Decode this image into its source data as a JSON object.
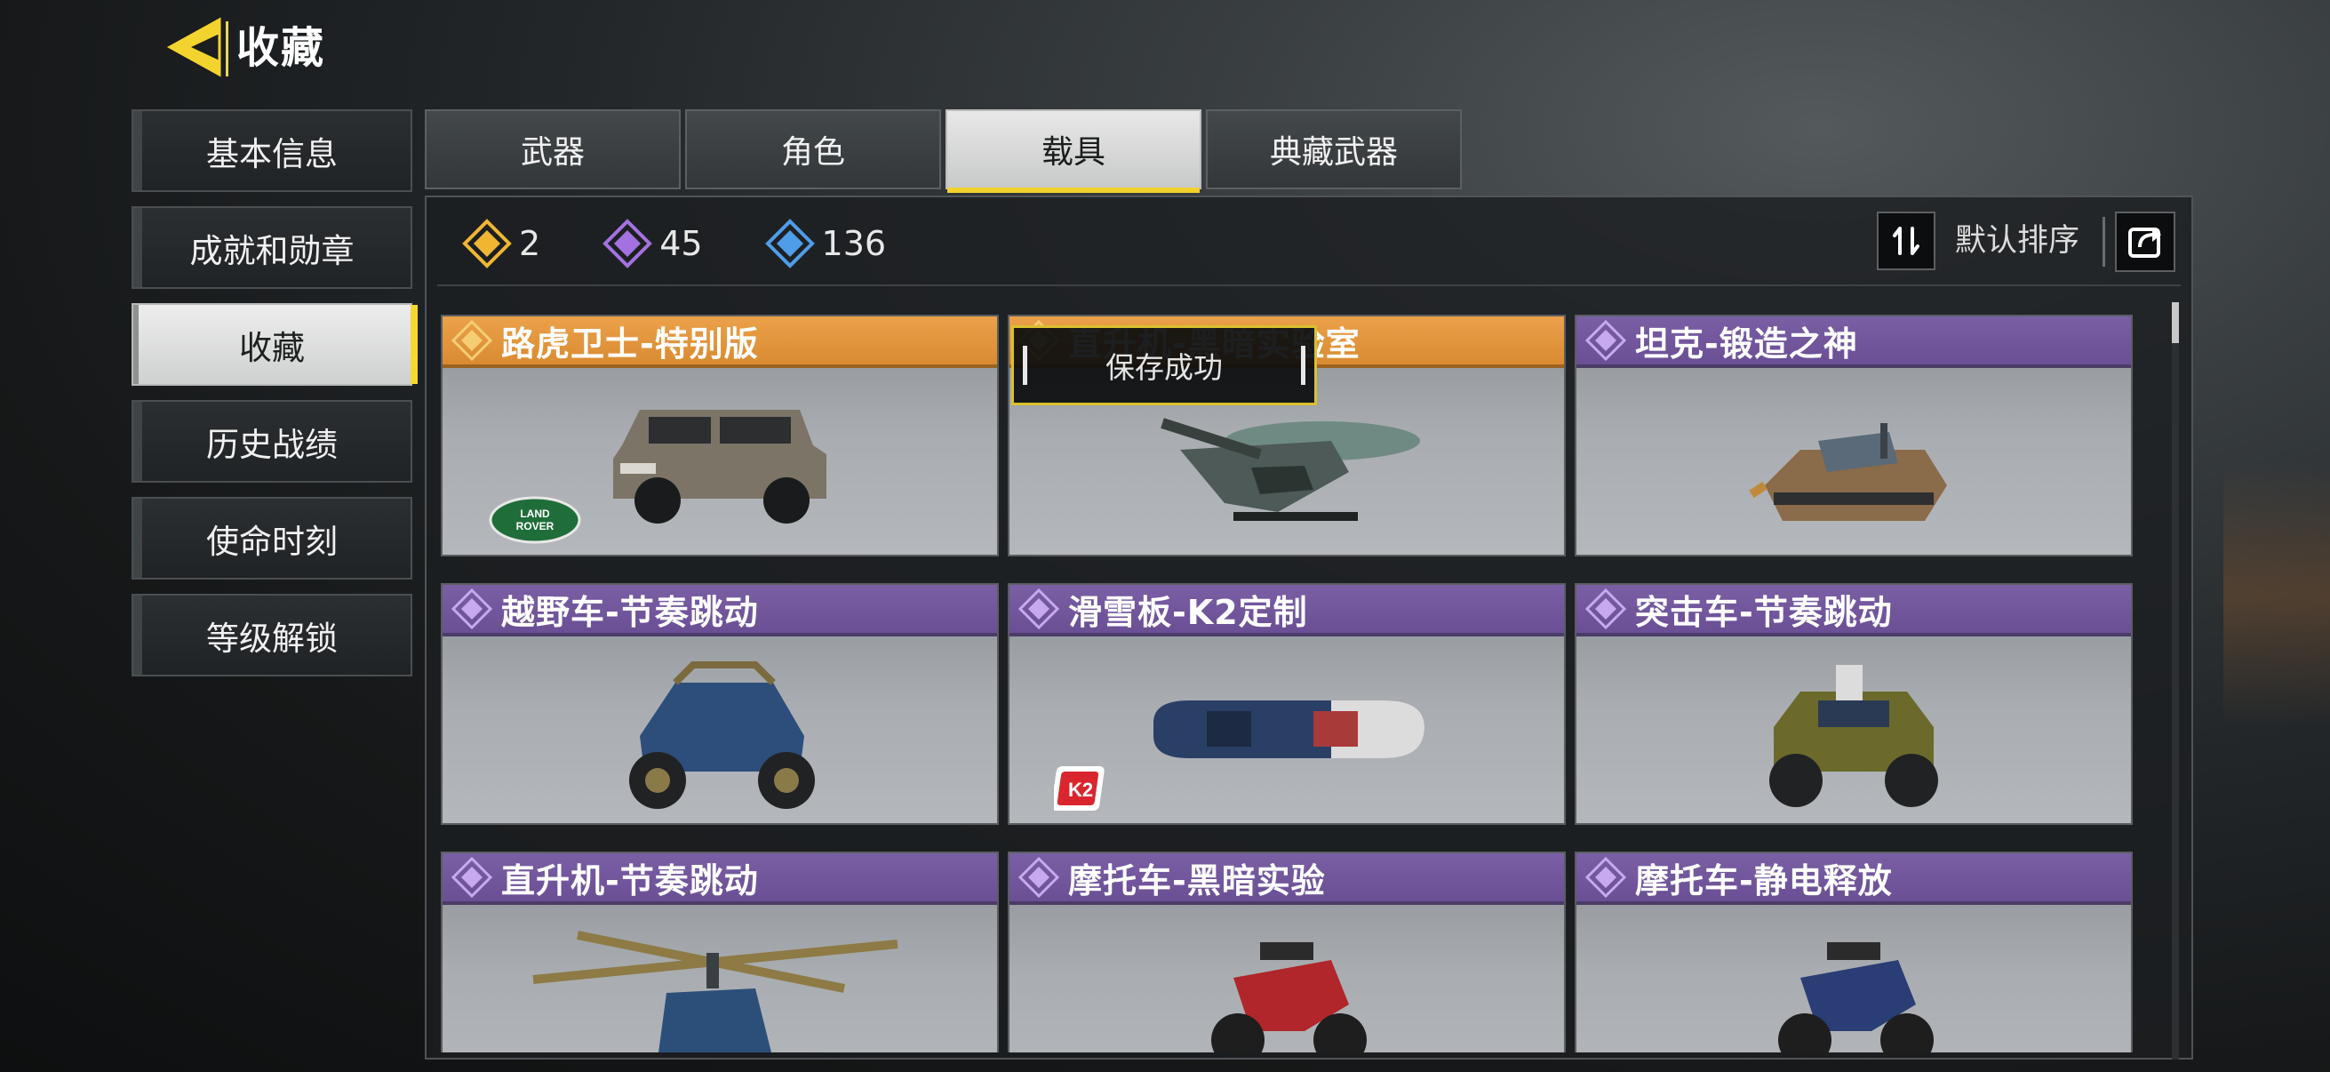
{
  "header": {
    "back_icon": "back-arrow-icon",
    "title": "收藏"
  },
  "nav": {
    "items": [
      {
        "label": "基本信息"
      },
      {
        "label": "成就和勋章"
      },
      {
        "label": "收藏",
        "active": true
      },
      {
        "label": "历史战绩"
      },
      {
        "label": "使命时刻"
      },
      {
        "label": "等级解锁"
      }
    ]
  },
  "tabs": [
    {
      "label": "武器"
    },
    {
      "label": "角色"
    },
    {
      "label": "载具",
      "active": true
    },
    {
      "label": "典藏武器"
    }
  ],
  "counts": [
    {
      "icon": "gold-diamond-icon",
      "color": "#f0b632",
      "value": "2"
    },
    {
      "icon": "purple-diamond-icon",
      "color": "#a472e0",
      "value": "45"
    },
    {
      "icon": "blue-diamond-icon",
      "color": "#4f9de8",
      "value": "136"
    }
  ],
  "sort": {
    "label": "默认排序",
    "toggle_icon": "sort-toggle-icon",
    "share_icon": "share-icon"
  },
  "cards": [
    {
      "name": "路虎卫士-特别版",
      "rarity": "legendary",
      "brand": "LAND ROVER"
    },
    {
      "name": "直升机-黑暗实验室",
      "rarity": "legendary"
    },
    {
      "name": "坦克-锻造之神",
      "rarity": "epic"
    },
    {
      "name": "越野车-节奏跳动",
      "rarity": "epic"
    },
    {
      "name": "滑雪板-K2定制",
      "rarity": "epic",
      "brand": "K2"
    },
    {
      "name": "突击车-节奏跳动",
      "rarity": "epic"
    },
    {
      "name": "直升机-节奏跳动",
      "rarity": "epic"
    },
    {
      "name": "摩托车-黑暗实验",
      "rarity": "epic"
    },
    {
      "name": "摩托车-静电释放",
      "rarity": "epic"
    }
  ],
  "toast": {
    "message": "保存成功"
  },
  "colors": {
    "accent": "#f2d22a",
    "legendary": "#e59a40",
    "epic": "#7258a0"
  }
}
